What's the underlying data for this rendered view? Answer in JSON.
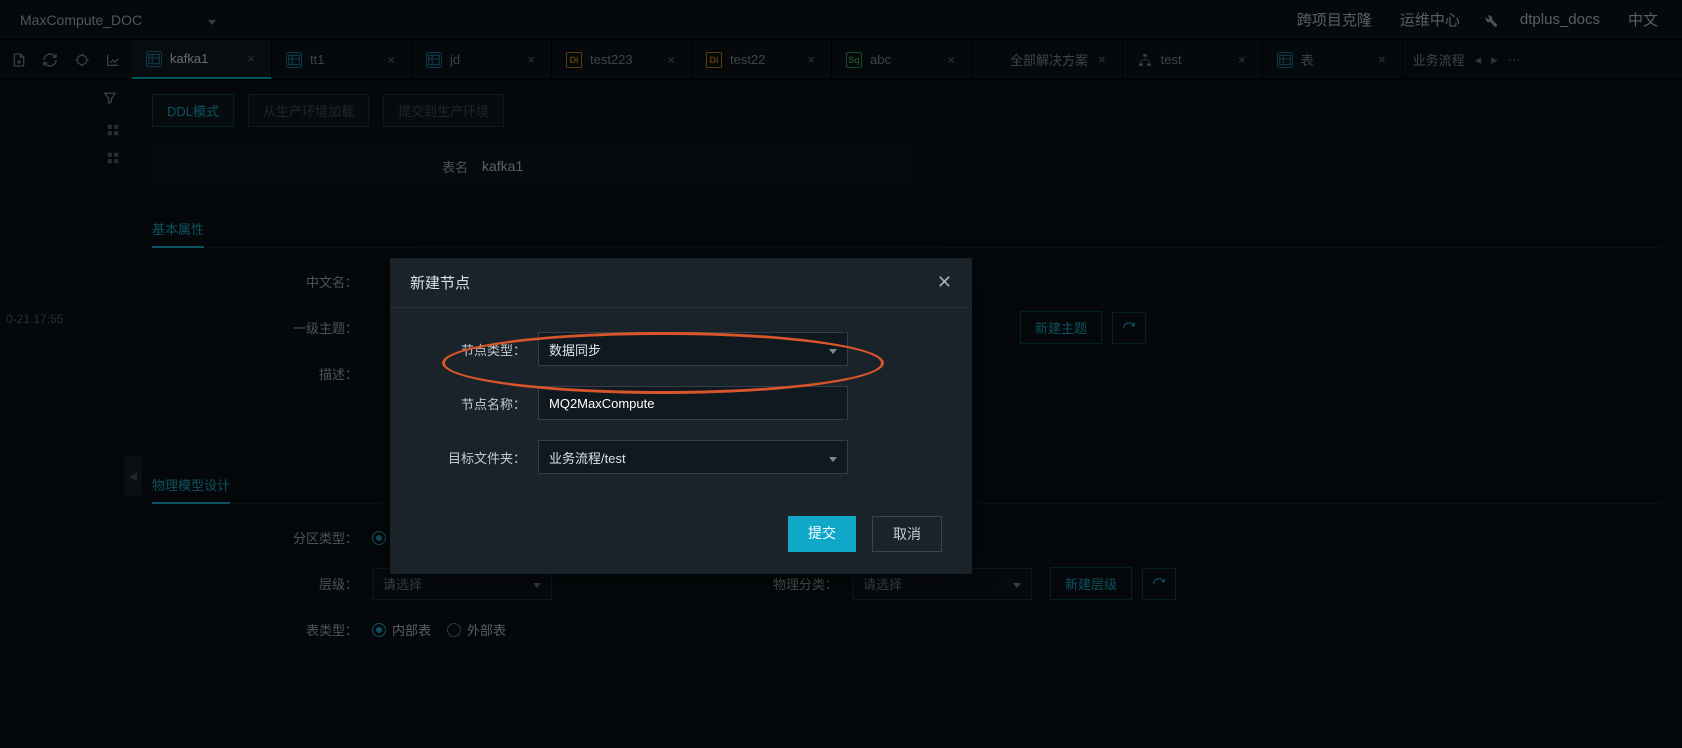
{
  "header": {
    "project": "MaxCompute_DOC",
    "links": {
      "clone": "跨项目克隆",
      "ops": "运维中心"
    },
    "user": "dtplus_docs",
    "lang": "中文"
  },
  "tabs": [
    {
      "icon": "tbl",
      "label": "kafka1",
      "active": true
    },
    {
      "icon": "tbl",
      "label": "tt1"
    },
    {
      "icon": "tbl",
      "label": "jd"
    },
    {
      "icon": "di",
      "label": "test223"
    },
    {
      "icon": "di",
      "label": "test22"
    },
    {
      "icon": "sq",
      "label": "abc"
    },
    {
      "icon": "txt",
      "label": "全部解决方案"
    },
    {
      "icon": "flow",
      "label": "test"
    },
    {
      "icon": "tbl",
      "label": "表"
    }
  ],
  "tabTail": "业务流程",
  "left": {
    "timestamp": "0-21 17:55"
  },
  "toolbar": {
    "ddl": "DDL模式",
    "load": "从生产环境加载",
    "submit": "提交到生产环境"
  },
  "page": {
    "tableName": {
      "label": "表名",
      "value": "kafka1"
    },
    "section1": "基本属性",
    "fields": {
      "cnName": "中文名：",
      "topic": "一级主题：",
      "desc": "描述：",
      "newTopic": "新建主题"
    },
    "section2": "物理模型设计",
    "fields2": {
      "partType": "分区类型：",
      "level": "层级：",
      "physCat": "物理分类：",
      "select": "请选择",
      "newLevel": "新建层级",
      "tableType": "表类型：",
      "inner": "内部表",
      "outer": "外部表"
    }
  },
  "modal": {
    "title": "新建节点",
    "nodeTypeLabel": "节点类型：",
    "nodeTypeValue": "数据同步",
    "nodeNameLabel": "节点名称：",
    "nodeNameValue": "MQ2MaxCompute",
    "folderLabel": "目标文件夹：",
    "folderValue": "业务流程/test",
    "submit": "提交",
    "cancel": "取消"
  }
}
